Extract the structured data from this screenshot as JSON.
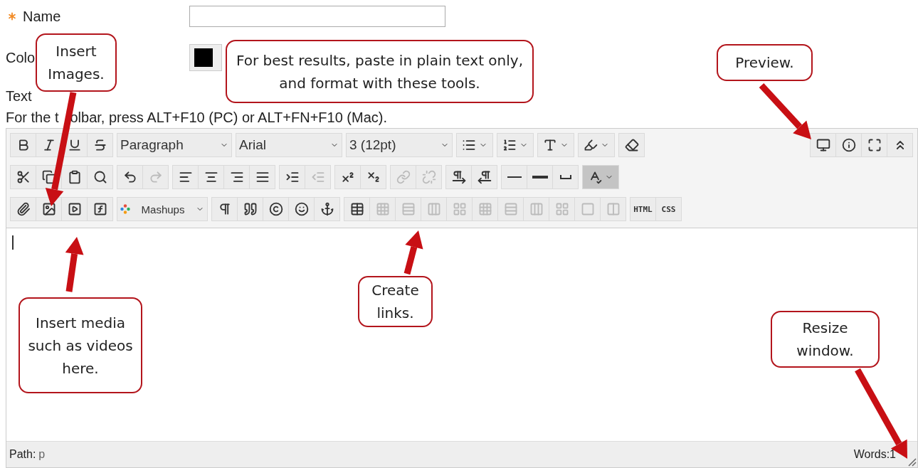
{
  "form": {
    "name_label": "Name",
    "required": true,
    "color_label": "Colo",
    "text_label": "Text",
    "hint_start": "For the t",
    "hint_end": "olbar, press ALT+F10 (PC) or ALT+FN+F10 (Mac)."
  },
  "toolbar": {
    "rows": [
      [
        {
          "buttons": [
            {
              "kind": "icon",
              "disabled": false,
              "pressed": false
            },
            {
              "kind": "icon",
              "disabled": false,
              "pressed": false
            },
            {
              "kind": "icon",
              "disabled": false,
              "pressed": false
            },
            {
              "kind": "icon",
              "disabled": false,
              "pressed": false
            }
          ]
        },
        {
          "buttons": [
            {
              "kind": "select",
              "value": "Paragraph"
            }
          ]
        },
        {
          "buttons": [
            {
              "kind": "select",
              "value": "Arial"
            }
          ]
        },
        {
          "buttons": [
            {
              "kind": "select",
              "value": "3 (12pt)"
            }
          ]
        },
        {
          "buttons": [
            {
              "kind": "split",
              "disabled": false,
              "pressed": false
            }
          ]
        },
        {
          "buttons": [
            {
              "kind": "split",
              "disabled": false,
              "pressed": false
            }
          ]
        },
        {
          "buttons": [
            {
              "kind": "split",
              "disabled": false,
              "pressed": false
            }
          ]
        },
        {
          "buttons": [
            {
              "kind": "split",
              "disabled": false,
              "pressed": false
            }
          ]
        },
        {
          "buttons": [
            {
              "kind": "icon",
              "disabled": false,
              "pressed": false
            }
          ]
        }
      ],
      [
        {
          "buttons": [
            {
              "kind": "icon",
              "disabled": false,
              "pressed": false
            },
            {
              "kind": "icon",
              "disabled": false,
              "pressed": false
            },
            {
              "kind": "icon",
              "disabled": false,
              "pressed": false
            },
            {
              "kind": "icon",
              "disabled": false,
              "pressed": false
            }
          ]
        },
        {
          "buttons": [
            {
              "kind": "icon",
              "disabled": false,
              "pressed": false
            },
            {
              "kind": "icon",
              "disabled": true,
              "pressed": false
            }
          ]
        },
        {
          "buttons": [
            {
              "kind": "icon",
              "disabled": false,
              "pressed": false
            },
            {
              "kind": "icon",
              "disabled": false,
              "pressed": false
            },
            {
              "kind": "icon",
              "disabled": false,
              "pressed": false
            },
            {
              "kind": "icon",
              "disabled": false,
              "pressed": false
            }
          ]
        },
        {
          "buttons": [
            {
              "kind": "icon",
              "disabled": false,
              "pressed": false
            },
            {
              "kind": "icon",
              "disabled": true,
              "pressed": false
            }
          ]
        },
        {
          "buttons": [
            {
              "kind": "icon",
              "disabled": false,
              "pressed": false
            },
            {
              "kind": "icon",
              "disabled": false,
              "pressed": false
            }
          ]
        },
        {
          "buttons": [
            {
              "kind": "icon",
              "disabled": true,
              "pressed": false
            },
            {
              "kind": "icon",
              "disabled": true,
              "pressed": false
            }
          ]
        },
        {
          "buttons": [
            {
              "kind": "icon",
              "disabled": false,
              "pressed": false
            },
            {
              "kind": "icon",
              "disabled": false,
              "pressed": false
            }
          ]
        },
        {
          "buttons": [
            {
              "kind": "icon",
              "disabled": false,
              "pressed": false
            },
            {
              "kind": "icon",
              "disabled": false,
              "pressed": false
            },
            {
              "kind": "icon",
              "disabled": false,
              "pressed": false
            }
          ]
        },
        {
          "buttons": [
            {
              "kind": "split",
              "disabled": false,
              "pressed": true
            }
          ]
        }
      ],
      [
        {
          "buttons": [
            {
              "kind": "icon",
              "disabled": false,
              "pressed": false
            },
            {
              "kind": "icon",
              "disabled": false,
              "pressed": false
            },
            {
              "kind": "icon",
              "disabled": false,
              "pressed": false
            },
            {
              "kind": "icon",
              "disabled": false,
              "pressed": false
            }
          ]
        },
        {
          "buttons": [
            {
              "kind": "menu",
              "label": "Mashups"
            }
          ]
        },
        {
          "buttons": [
            {
              "kind": "icon",
              "disabled": false,
              "pressed": false
            },
            {
              "kind": "icon",
              "disabled": false,
              "pressed": false
            },
            {
              "kind": "icon",
              "disabled": false,
              "pressed": false
            },
            {
              "kind": "icon",
              "disabled": false,
              "pressed": false
            },
            {
              "kind": "icon",
              "disabled": false,
              "pressed": false
            }
          ]
        },
        {
          "buttons": [
            {
              "kind": "icon",
              "disabled": false,
              "pressed": false
            },
            {
              "kind": "icon",
              "disabled": true,
              "pressed": false
            },
            {
              "kind": "icon",
              "disabled": true,
              "pressed": false
            },
            {
              "kind": "icon",
              "disabled": true,
              "pressed": false
            },
            {
              "kind": "icon",
              "disabled": true,
              "pressed": false
            },
            {
              "kind": "icon",
              "disabled": true,
              "pressed": false
            },
            {
              "kind": "icon",
              "disabled": true,
              "pressed": false
            },
            {
              "kind": "icon",
              "disabled": true,
              "pressed": false
            },
            {
              "kind": "icon",
              "disabled": true,
              "pressed": false
            },
            {
              "kind": "icon",
              "disabled": true,
              "pressed": false
            },
            {
              "kind": "icon",
              "disabled": true,
              "pressed": false
            }
          ]
        },
        {
          "buttons": [
            {
              "kind": "text",
              "label": "HTML"
            },
            {
              "kind": "text",
              "label": "CSS"
            }
          ]
        }
      ]
    ],
    "side_tools": [
      {
        "disabled": false
      },
      {
        "disabled": false
      },
      {
        "disabled": false
      },
      {
        "disabled": false
      }
    ]
  },
  "status_bar": {
    "path_label": "Path:",
    "path_value": "p",
    "words": "Words:1"
  },
  "callouts": [
    {
      "text": "Insert Images."
    },
    {
      "text": "For best results, paste in plain text only, and format with these tools."
    },
    {
      "text": "Preview."
    },
    {
      "text": "Insert media such as videos here."
    },
    {
      "text": "Create links."
    },
    {
      "text": "Resize window."
    }
  ]
}
